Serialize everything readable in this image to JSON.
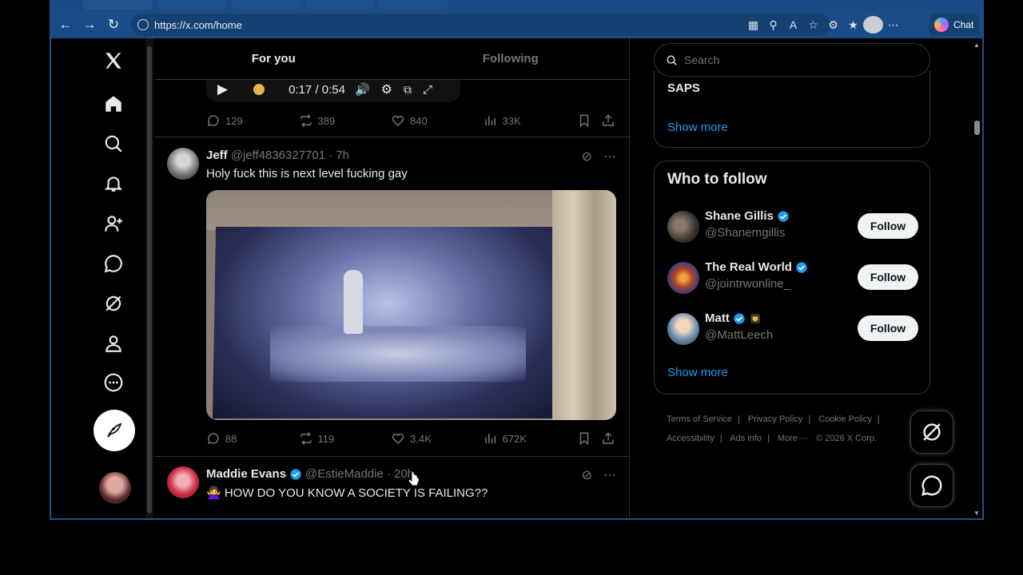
{
  "browser": {
    "url": "https://x.com/home",
    "chat_label": "Chat"
  },
  "feed": {
    "tabs": [
      {
        "label": "For you",
        "active": true
      },
      {
        "label": "Following",
        "active": false
      }
    ],
    "video_player": {
      "time": "0:17 / 0:54"
    },
    "posts": [
      {
        "stats": {
          "replies": "129",
          "reposts": "389",
          "likes": "840",
          "views": "33K"
        }
      },
      {
        "name": "Jeff",
        "handle": "@jeff4836327701",
        "time": "· 7h",
        "text": "Holy fuck this is next level fucking gay",
        "stats": {
          "replies": "88",
          "reposts": "119",
          "likes": "3.4K",
          "views": "672K"
        }
      },
      {
        "name": "Maddie Evans",
        "handle": "@EstieMaddie",
        "time": "· 20h",
        "text": "🙅‍♀️ HOW DO YOU KNOW A SOCIETY IS FAILING??"
      }
    ]
  },
  "sidebar_right": {
    "search_placeholder": "Search",
    "trending_tail": "SAPS",
    "show_more_1": "Show more",
    "who_to_follow": {
      "title": "Who to follow",
      "people": [
        {
          "name": "Shane Gillis",
          "handle": "@Shanemgillis",
          "button": "Follow"
        },
        {
          "name": "The Real World",
          "handle": "@jointrwonline_",
          "button": "Follow"
        },
        {
          "name": "Matt",
          "handle": "@MattLeech",
          "button": "Follow"
        }
      ],
      "show_more": "Show more"
    },
    "footer": {
      "links": [
        "Terms of Service",
        "Privacy Policy",
        "Cookie Policy",
        "Accessibility",
        "Ads info",
        "More ···"
      ],
      "copyright": "© 2026 X Corp."
    }
  },
  "colors": {
    "accent": "#1d9bf0",
    "browser_chrome": "#1b4b86",
    "background": "#000000"
  }
}
